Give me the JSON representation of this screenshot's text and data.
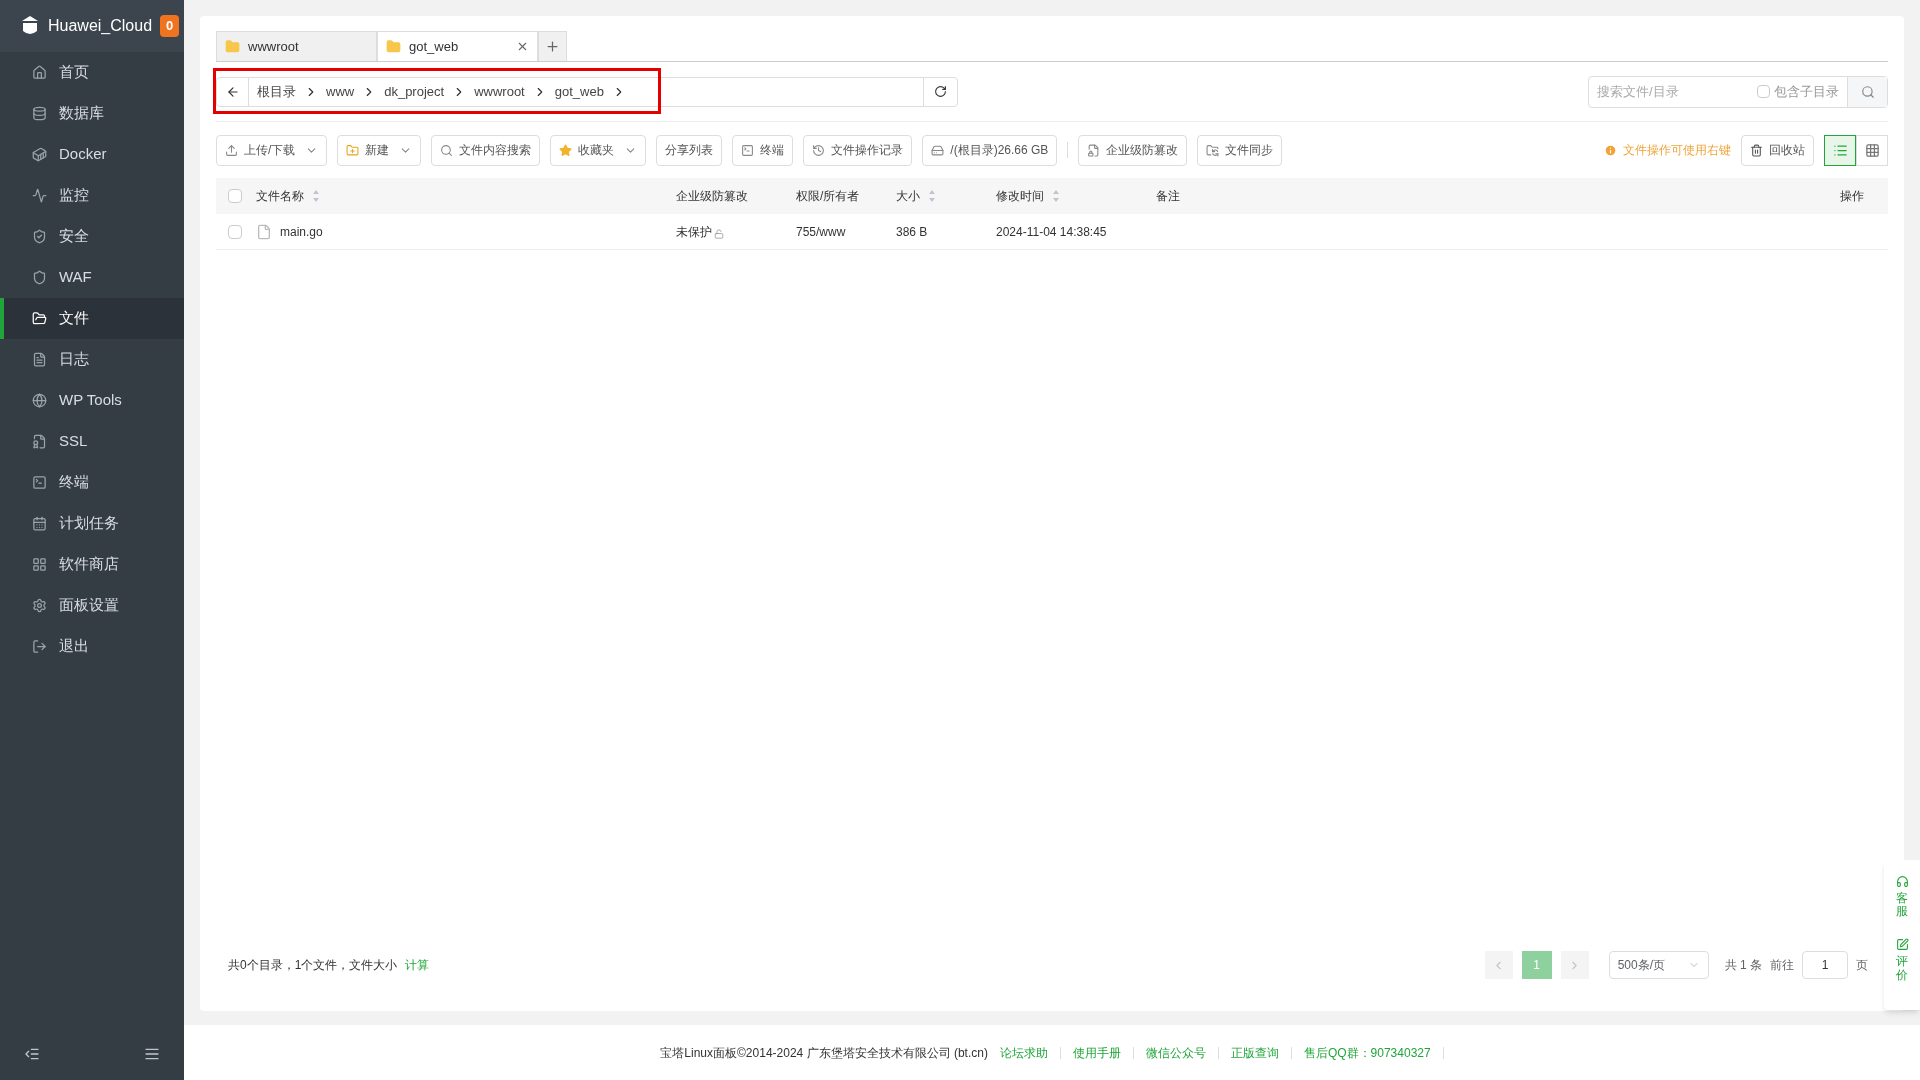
{
  "sidebar": {
    "brand": "Huawei_Cloud",
    "badge": "0",
    "items": [
      {
        "label": "首页",
        "selected": false
      },
      {
        "label": "数据库",
        "selected": false
      },
      {
        "label": "Docker",
        "selected": false
      },
      {
        "label": "监控",
        "selected": false
      },
      {
        "label": "安全",
        "selected": false
      },
      {
        "label": "WAF",
        "selected": false
      },
      {
        "label": "文件",
        "selected": true
      },
      {
        "label": "日志",
        "selected": false
      },
      {
        "label": "WP Tools",
        "selected": false
      },
      {
        "label": "SSL",
        "selected": false
      },
      {
        "label": "终端",
        "selected": false
      },
      {
        "label": "计划任务",
        "selected": false
      },
      {
        "label": "软件商店",
        "selected": false
      },
      {
        "label": "面板设置",
        "selected": false
      },
      {
        "label": "退出",
        "selected": false
      }
    ]
  },
  "tabs": [
    {
      "label": "wwwroot",
      "selected": false
    },
    {
      "label": "got_web",
      "selected": true
    }
  ],
  "breadcrumb": [
    "根目录",
    "www",
    "dk_project",
    "wwwroot",
    "got_web"
  ],
  "search": {
    "placeholder": "搜索文件/目录",
    "include_subdirs": {
      "label": "包含子目录",
      "checked": false
    }
  },
  "toolbar": [
    {
      "label": "上传/下载",
      "kind": "dropdown"
    },
    {
      "label": "新建",
      "kind": "dropdown"
    },
    {
      "label": "文件内容搜索",
      "kind": "plain"
    },
    {
      "label": "收藏夹",
      "kind": "dropdown"
    },
    {
      "label": "分享列表",
      "kind": "plain"
    },
    {
      "label": "终端",
      "kind": "plain"
    },
    {
      "label": "文件操作记录",
      "kind": "plain"
    },
    {
      "label": "/(根目录)26.66 GB",
      "kind": "plain"
    },
    {
      "label": "企业级防篡改",
      "kind": "plain"
    },
    {
      "label": "文件同步",
      "kind": "plain"
    }
  ],
  "hint": "文件操作可使用右键",
  "recycle": "回收站",
  "views": [
    {
      "selected": true
    },
    {
      "selected": false
    }
  ],
  "table": {
    "header_checked": false,
    "columns": [
      {
        "label": "文件名称",
        "sortable": true
      },
      {
        "label": "企业级防篡改",
        "sortable": false
      },
      {
        "label": "权限/所有者",
        "sortable": false
      },
      {
        "label": "大小",
        "sortable": true
      },
      {
        "label": "修改时间",
        "sortable": true
      },
      {
        "label": "备注",
        "sortable": false
      },
      {
        "label": "操作",
        "sortable": false
      }
    ],
    "rows": [
      {
        "checked": false,
        "name": "main.go",
        "protection": "未保护",
        "permission": "755/www",
        "size": "386 B",
        "modified": "2024-11-04 14:38:45"
      }
    ]
  },
  "summary": {
    "text": "共0个目录，1个文件，文件大小",
    "link": "计算"
  },
  "pagination": {
    "pages": [
      {
        "label": "1",
        "selected": true
      }
    ],
    "page_size": "500条/页",
    "total": "共 1 条",
    "goto": "前往",
    "goto_value": "1",
    "unit": "页"
  },
  "float_widget": [
    "客服",
    "评价"
  ],
  "footer": {
    "copyright": "宝塔Linux面板©2014-2024 广东堡塔安全技术有限公司 (bt.cn)",
    "links": [
      "论坛求助",
      "使用手册",
      "微信公众号",
      "正版查询",
      "售后QQ群：907340327"
    ]
  }
}
